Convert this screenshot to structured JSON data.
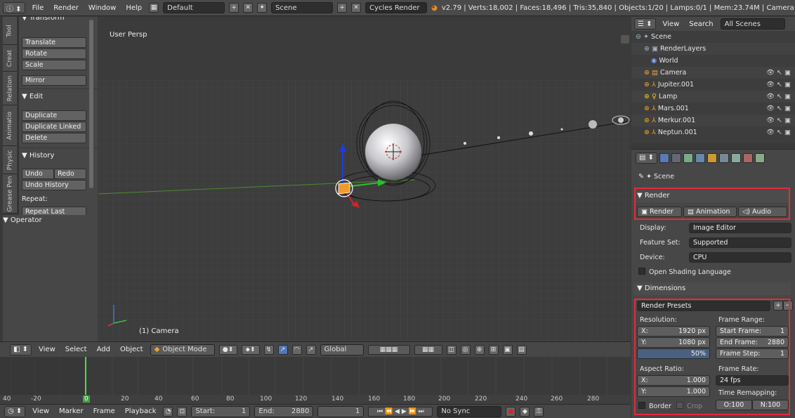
{
  "topbar": {
    "menus": [
      "File",
      "Render",
      "Window",
      "Help"
    ],
    "layout": "Default",
    "scene": "Scene",
    "engine": "Cycles Render",
    "stats": "v2.79 | Verts:18,002 | Faces:18,496 | Tris:35,840 | Objects:1/20 | Lamps:0/1 | Mem:23.74M | Camera"
  },
  "tabs": [
    "Tool",
    "Creat",
    "Relation",
    "Animatio",
    "Physic",
    "Grease Pen"
  ],
  "toolshelf": {
    "transform_header": "▼ Transform",
    "translate": "Translate",
    "rotate": "Rotate",
    "scale": "Scale",
    "mirror": "Mirror",
    "edit_header": "▼ Edit",
    "duplicate": "Duplicate",
    "duplicate_linked": "Duplicate Linked",
    "delete": "Delete",
    "history_header": "▼ History",
    "undo": "Undo",
    "redo": "Redo",
    "undo_history": "Undo History",
    "repeat": "Repeat:",
    "repeat_last": "Repeat Last",
    "operator_header": "▼ Operator"
  },
  "viewport": {
    "view_name": "User Persp",
    "object_label": "(1) Camera"
  },
  "viewheader": {
    "view": "View",
    "select": "Select",
    "add": "Add",
    "object": "Object",
    "mode": "Object Mode",
    "orientation": "Global"
  },
  "timeline": {
    "ruler": [
      "40",
      "-20",
      "0",
      "20",
      "40",
      "60",
      "80",
      "100",
      "120",
      "140",
      "160",
      "180",
      "200",
      "220",
      "240",
      "260",
      "280"
    ]
  },
  "bottombar": {
    "view": "View",
    "marker": "Marker",
    "frame": "Frame",
    "playback": "Playback",
    "start_label": "Start:",
    "start_val": "1",
    "end_label": "End:",
    "end_val": "2880",
    "current": "1",
    "sync": "No Sync"
  },
  "outliner": {
    "view": "View",
    "search": "Search",
    "filter": "All Scenes",
    "rows": [
      "Scene",
      "RenderLayers",
      "World",
      "Camera",
      "Jupiter.001",
      "Lamp",
      "Mars.001",
      "Merkur.001",
      "Neptun.001"
    ]
  },
  "properties": {
    "context": "Scene",
    "render_header": "▼ Render",
    "render_btn": "Render",
    "animation_btn": "Animation",
    "audio_btn": "Audio",
    "display_label": "Display:",
    "display_val": "Image Editor",
    "feature_label": "Feature Set:",
    "feature_val": "Supported",
    "device_label": "Device:",
    "device_val": "CPU",
    "osl": "Open Shading Language",
    "dimensions_header": "▼ Dimensions",
    "presets": "Render Presets",
    "resolution": "Resolution:",
    "res_x_label": "X:",
    "res_x": "1920 px",
    "res_y_label": "Y:",
    "res_y": "1080 px",
    "res_pct": "50%",
    "frame_range": "Frame Range:",
    "start_frame_label": "Start Frame:",
    "start_frame": "1",
    "end_frame_label": "End Frame:",
    "end_frame": "2880",
    "frame_step_label": "Frame Step:",
    "frame_step": "1",
    "aspect": "Aspect Ratio:",
    "asp_x_label": "X:",
    "asp_x": "1.000",
    "asp_y_label": "Y:",
    "asp_y": "1.000",
    "frame_rate": "Frame Rate:",
    "fps": "24 fps",
    "time_remap": "Time Remapping:",
    "border": "Border",
    "crop": "Crop",
    "remap_old": "O:100",
    "remap_new": "N:100"
  }
}
